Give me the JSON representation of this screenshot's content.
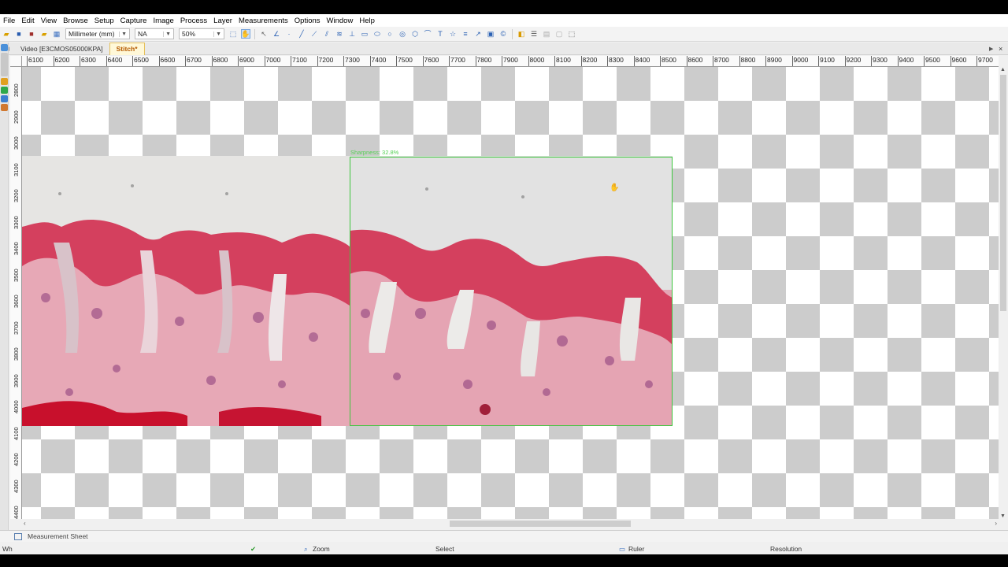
{
  "menu": [
    "File",
    "Edit",
    "View",
    "Browse",
    "Setup",
    "Capture",
    "Image",
    "Process",
    "Layer",
    "Measurements",
    "Options",
    "Window",
    "Help"
  ],
  "toolbar": {
    "unit_select": "Millimeter (mm)",
    "objective_select": "NA",
    "zoom_select": "50%"
  },
  "tabs": [
    {
      "label": "Video [E3CMOS05000KPA]"
    },
    {
      "label": "Stitch*"
    }
  ],
  "hruler": [
    "6100",
    "6200",
    "6300",
    "6400",
    "6500",
    "6600",
    "6700",
    "6800",
    "6900",
    "7000",
    "7100",
    "7200",
    "7300",
    "7400",
    "7500",
    "7600",
    "7700",
    "7800",
    "7900",
    "8000",
    "8100",
    "8200",
    "8300",
    "8400",
    "8500",
    "8600",
    "8700",
    "8800",
    "8900",
    "9000",
    "9100",
    "9200",
    "9300",
    "9400",
    "9500",
    "9600",
    "9700"
  ],
  "vruler": [
    "2800",
    "2900",
    "3000",
    "3100",
    "3200",
    "3300",
    "3400",
    "3500",
    "3600",
    "3700",
    "3800",
    "3900",
    "4000",
    "4100",
    "4200",
    "4300",
    "4400"
  ],
  "canvas": {
    "sharpness": "Sharpness: 32.8%"
  },
  "sheet_tab": "Measurement Sheet",
  "status": {
    "left": "Wh",
    "zoom": "Zoom",
    "select": "Select",
    "ruler": "Ruler",
    "resolution": "Resolution"
  },
  "colors": {
    "active_tab": "#b55a00",
    "stitch_frame": "#3ec63e",
    "tissue_pink": "#d4405e",
    "tissue_purple": "#9a4a8a"
  }
}
